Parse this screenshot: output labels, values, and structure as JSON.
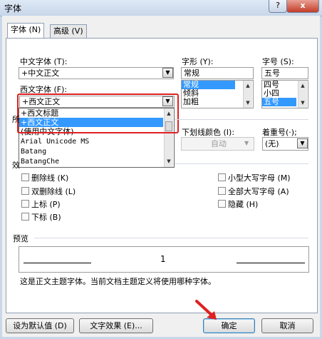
{
  "window": {
    "title": "字体",
    "help": "?",
    "close": "x"
  },
  "tabs": [
    {
      "label": "字体 (N)"
    },
    {
      "label": "高级 (V)"
    }
  ],
  "chinese_font": {
    "label": "中文字体 (T):",
    "value": "+中文正文"
  },
  "style": {
    "label": "字形 (Y):",
    "value": "常规",
    "options": [
      "常规",
      "倾斜",
      "加粗"
    ]
  },
  "size": {
    "label": "字号 (S):",
    "value": "五号",
    "options": [
      "四号",
      "小四",
      "五号"
    ]
  },
  "western_font": {
    "label": "西文字体 (F):",
    "value": "+西文正文",
    "options": [
      "+西文标题",
      "+西文正文",
      "(使用中文字体)",
      "Arial Unicode MS",
      "Batang",
      "BatangChe"
    ],
    "selected_index": 1
  },
  "all_text_partial": "所",
  "effects_partial": "效",
  "underline_color": {
    "label": "下划线颜色 (I):",
    "value": "自动"
  },
  "emphasis": {
    "label": "着重号(·);",
    "value": "(无)"
  },
  "effects_left": [
    {
      "label": "删除线 (K)"
    },
    {
      "label": "双删除线 (L)"
    },
    {
      "label": "上标 (P)"
    },
    {
      "label": "下标 (B)"
    }
  ],
  "effects_right": [
    {
      "label": "小型大写字母 (M)"
    },
    {
      "label": "全部大写字母 (A)"
    },
    {
      "label": "隐藏 (H)"
    }
  ],
  "preview": {
    "label": "预览",
    "text": "1",
    "note": "这是正文主题字体。当前文档主题定义将使用哪种字体。"
  },
  "buttons": {
    "set_default": "设为默认值 (D)",
    "text_effects": "文字效果 (E)...",
    "ok": "确定",
    "cancel": "取消"
  },
  "colors": {
    "highlight": "#3399ff",
    "annotation": "#e02020"
  }
}
